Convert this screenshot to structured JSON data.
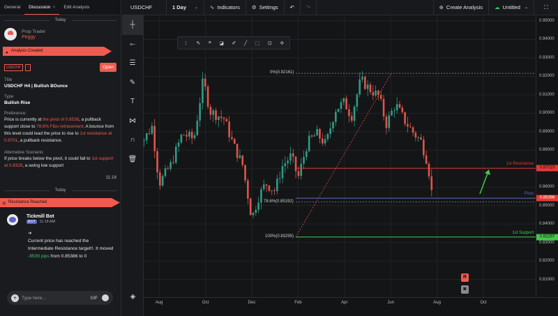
{
  "panel": {
    "tabs": [
      {
        "label": "General"
      },
      {
        "label": "Discussion",
        "close": "×"
      },
      {
        "label": "Edit Analysis"
      }
    ],
    "day1": "Today",
    "trader": {
      "role": "Prop Trader",
      "name": "Peggy"
    },
    "analysis_created": "Analysis Created",
    "pair_tag": "USDCHF",
    "open_label": "Open",
    "title_label": "Title",
    "title_value": "USDCHF H4 | Bullish BOunce",
    "type_label": "Type",
    "type_value": "Bullish Rise",
    "pref_label": "Preference:",
    "pref": {
      "p1": "Price is currently at ",
      "h1": "the pivot of 0.8538",
      "p2": ", a pullback support close to ",
      "h2": "78.6% Fibo retracement",
      "p3": ". A bounce from this level could lead the price to rise to ",
      "h3": "1st resistance at 0.8701",
      "p4": ", a pullback resistance."
    },
    "alt_label": "Alternative Scenario:",
    "alt": {
      "p1": "If price breaks below the pivot, it could fall to ",
      "h1": "1st support at 0.8329",
      "p2": ", a swing low support"
    },
    "time1": "11:18",
    "day2": "Today",
    "resistance_reached": "Resistance Reached",
    "bot": {
      "name": "Tickmill Bot",
      "badge": "BOT",
      "time": "11:18 AM"
    },
    "msg": {
      "arrow": "➜",
      "p1": "Current price has reached the Intermediate Resistance target!!. It moved ",
      "pips": "-8539 pips",
      "p2": " from 0.85386 to 0"
    },
    "chat": {
      "placeholder": "Type here...",
      "gif": "GIF"
    }
  },
  "header": {
    "symbol": "USDCHF",
    "interval": "1 Day",
    "indicators": "Indicators",
    "settings": "Settings",
    "create": "Create Analysis",
    "untitled": "Untitled"
  },
  "icons": {
    "tools": [
      "crosshair-icon",
      "horizontal-ray-icon",
      "fib-retracement-icon",
      "brush-icon",
      "text-icon",
      "pattern-icon",
      "magnet-icon",
      "trash-icon"
    ],
    "bottom": "layers-icon"
  },
  "colors": {
    "accent": "#f05b50",
    "resistance": "#e53935",
    "support": "#43c84a",
    "pivot": "#5c6bc0",
    "up": "#2f9c86",
    "down": "#e0554a"
  },
  "chart_data": {
    "type": "candlestick",
    "title": "",
    "symbol": "USDCHF",
    "interval": "1 Day",
    "y_ticks": [
      "0.95000",
      "0.94000",
      "0.93000",
      "0.92000",
      "0.91000",
      "0.90000",
      "0.89000",
      "0.88000",
      "0.87000",
      "0.86000",
      "0.85000",
      "0.84000",
      "0.83000",
      "0.82000",
      "0.81000"
    ],
    "ylim": [
      0.8,
      0.95
    ],
    "x_ticks": [
      "Aug",
      "Oct",
      "Dec",
      "Feb",
      "Apr",
      "Jun",
      "Aug",
      "Oct"
    ],
    "x_tick_values": [
      1,
      3,
      5,
      7,
      9,
      11,
      13,
      15
    ],
    "price_path": [
      [
        0,
        0.896
      ],
      [
        0.3,
        0.885
      ],
      [
        0.7,
        0.893
      ],
      [
        1,
        0.862
      ],
      [
        1.5,
        0.872
      ],
      [
        2,
        0.889
      ],
      [
        2.5,
        0.886
      ],
      [
        2.9,
        0.918
      ],
      [
        3.2,
        0.901
      ],
      [
        3.8,
        0.897
      ],
      [
        4.2,
        0.883
      ],
      [
        4.6,
        0.872
      ],
      [
        5,
        0.843
      ],
      [
        5.3,
        0.855
      ],
      [
        5.6,
        0.862
      ],
      [
        6,
        0.858
      ],
      [
        6.3,
        0.871
      ],
      [
        6.7,
        0.877
      ],
      [
        7,
        0.865
      ],
      [
        7.4,
        0.884
      ],
      [
        7.8,
        0.889
      ],
      [
        8.2,
        0.883
      ],
      [
        8.6,
        0.902
      ],
      [
        9,
        0.906
      ],
      [
        9.3,
        0.898
      ],
      [
        9.7,
        0.918
      ],
      [
        10.1,
        0.913
      ],
      [
        10.5,
        0.909
      ],
      [
        10.8,
        0.894
      ],
      [
        11.2,
        0.905
      ],
      [
        11.6,
        0.896
      ],
      [
        12,
        0.889
      ],
      [
        12.3,
        0.885
      ],
      [
        12.6,
        0.873
      ],
      [
        12.8,
        0.854
      ]
    ],
    "levels": [
      {
        "name": "1st Resistance",
        "value": 0.87019,
        "label": "0.87019"
      },
      {
        "name": "Pivot",
        "value": 0.85398,
        "label": "0.85398"
      },
      {
        "name": "1st Support",
        "value": 0.83297,
        "label": "0.83297"
      }
    ],
    "fibonacci": [
      {
        "label": "0%(0.92161)",
        "value": 0.92161
      },
      {
        "label": "78.6%(0.85192)",
        "value": 0.85192
      },
      {
        "label": "100%(0.83295)",
        "value": 0.83295
      }
    ]
  }
}
